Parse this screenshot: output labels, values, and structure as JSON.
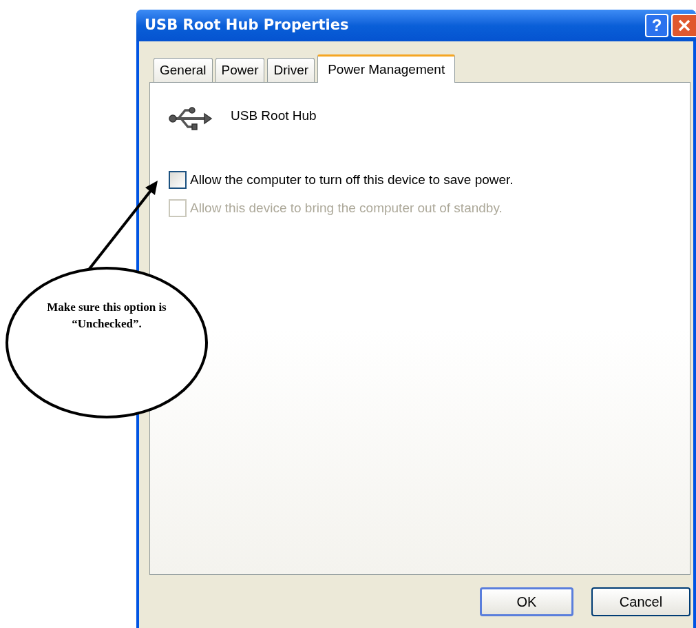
{
  "window": {
    "title": "USB Root Hub Properties",
    "help_button": "?"
  },
  "tabs": [
    {
      "label": "General",
      "selected": false
    },
    {
      "label": "Power",
      "selected": false
    },
    {
      "label": "Driver",
      "selected": false
    },
    {
      "label": "Power Management",
      "selected": true
    }
  ],
  "device": {
    "name": "USB Root Hub"
  },
  "options": [
    {
      "label": "Allow the computer to turn off this device to save power.",
      "checked": false,
      "disabled": false
    },
    {
      "label": "Allow this device to bring the computer out of standby.",
      "checked": false,
      "disabled": true
    }
  ],
  "buttons": [
    {
      "label": "OK",
      "default": true
    },
    {
      "label": "Cancel",
      "default": false
    }
  ],
  "callout": {
    "text": "Make sure this option is “Unchecked”."
  }
}
